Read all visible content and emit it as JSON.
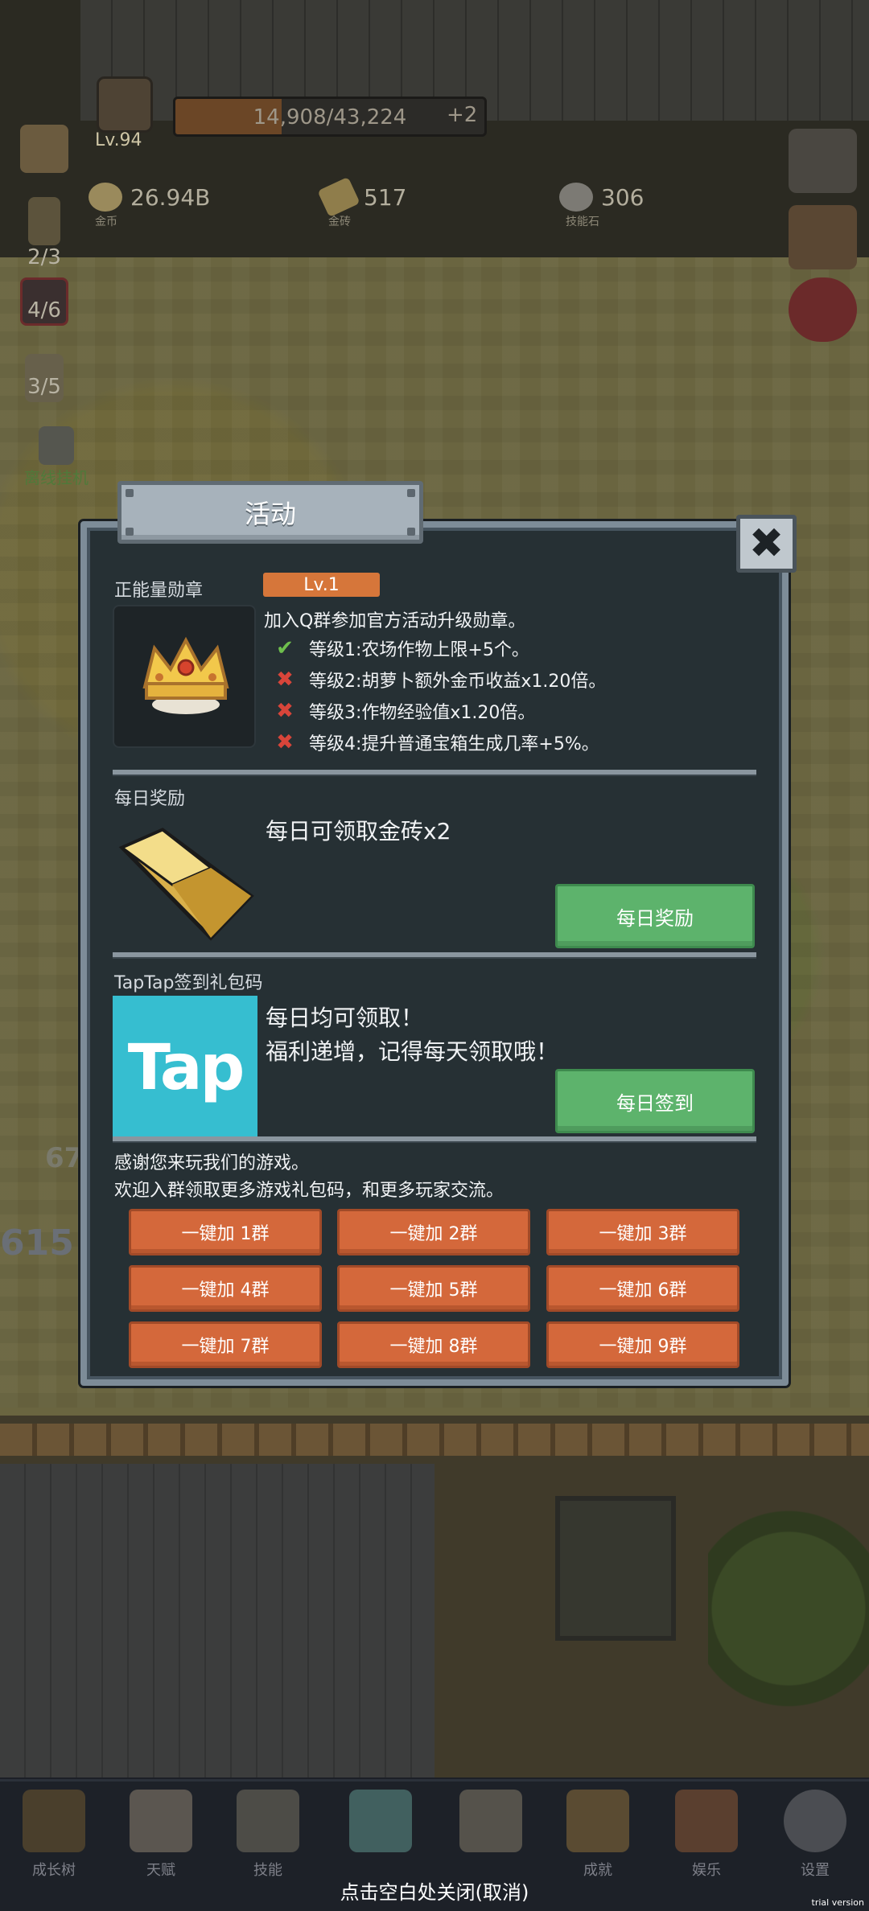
{
  "hud": {
    "level": "Lv.94",
    "xp_text": "14,908/43,224",
    "xp_fraction": 0.345,
    "xp_bonus": "+2",
    "gold_value": "26.94B",
    "gold_caption": "金币",
    "brick_value": "517",
    "brick_caption": "金砖",
    "stone_value": "306",
    "stone_caption": "技能石",
    "side": {
      "candle": "2/3",
      "dice": "4/6",
      "cup": "3/5",
      "auto_label": "离线挂机"
    },
    "stray_a": "67",
    "stray_b": "615"
  },
  "dialog": {
    "title": "活动",
    "close_label": "✖",
    "medal": {
      "section_title": "正能量勋章",
      "level": "Lv.1",
      "description": "加入Q群参加官方活动升级勋章。",
      "tiers": [
        {
          "text": "等级1:农场作物上限+5个。",
          "status": "✔"
        },
        {
          "text": "等级2:胡萝卜额外金币收益x1.20倍。",
          "status": "✖"
        },
        {
          "text": "等级3:作物经验值x1.20倍。",
          "status": "✖"
        },
        {
          "text": "等级4:提升普通宝箱生成几率+5%。",
          "status": "✖"
        }
      ]
    },
    "daily": {
      "section_title": "每日奖励",
      "text": "每日可领取金砖x2",
      "button": "每日奖励"
    },
    "taptap": {
      "section_title": "TapTap签到礼包码",
      "logo_text": "Tap",
      "line1": "每日均可领取！",
      "line2": "福利递增，记得每天领取哦！",
      "button": "每日签到"
    },
    "groups": {
      "thanks1": "感谢您来玩我们的游戏。",
      "thanks2": "欢迎入群领取更多游戏礼包码，和更多玩家交流。",
      "buttons": [
        "一键加 1群",
        "一键加 2群",
        "一键加 3群",
        "一键加 4群",
        "一键加 5群",
        "一键加 6群",
        "一键加 7群",
        "一键加 8群",
        "一键加 9群"
      ]
    }
  },
  "bottom": {
    "tabs": [
      "成长树",
      "天赋",
      "技能",
      "",
      "",
      "成就",
      "娱乐",
      "设置"
    ],
    "close_hint": "点击空白处关闭(取消)"
  },
  "watermark": "trial version",
  "colors": {
    "panel_bg": "#263034",
    "orange_button": "#d4683b",
    "green_button": "#5db36c",
    "taptap": "#36bed0"
  }
}
